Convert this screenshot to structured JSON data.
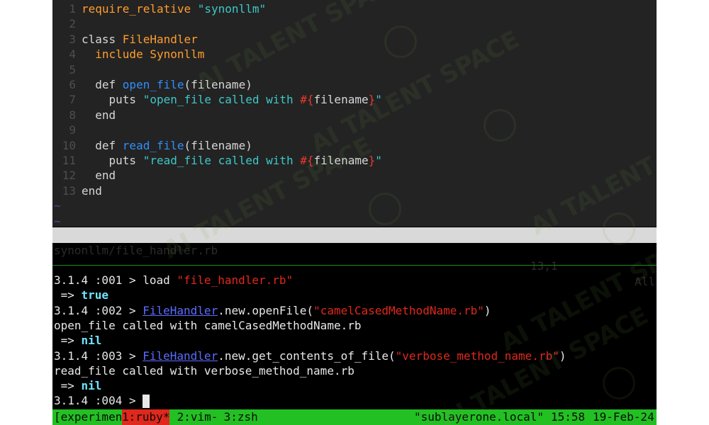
{
  "editor": {
    "lines": [
      {
        "n": "1",
        "segments": [
          {
            "t": "require_relative ",
            "c": "kw-o"
          },
          {
            "t": "\"synonllm\"",
            "c": "str"
          }
        ]
      },
      {
        "n": "2",
        "segments": []
      },
      {
        "n": "3",
        "segments": [
          {
            "t": "class ",
            "c": "kw"
          },
          {
            "t": "FileHandler",
            "c": "kw-o"
          }
        ]
      },
      {
        "n": "4",
        "segments": [
          {
            "t": "  include ",
            "c": "kw-o"
          },
          {
            "t": "Synonllm",
            "c": "kw-o"
          }
        ]
      },
      {
        "n": "5",
        "segments": []
      },
      {
        "n": "6",
        "segments": [
          {
            "t": "  def ",
            "c": "kw"
          },
          {
            "t": "open_file",
            "c": "fn"
          },
          {
            "t": "(filename)",
            "c": "kw"
          }
        ]
      },
      {
        "n": "7",
        "segments": [
          {
            "t": "    puts ",
            "c": "kw"
          },
          {
            "t": "\"open_file called with ",
            "c": "str"
          },
          {
            "t": "#{",
            "c": "interp"
          },
          {
            "t": "filename",
            "c": "kw"
          },
          {
            "t": "}",
            "c": "interp"
          },
          {
            "t": "\"",
            "c": "str"
          }
        ]
      },
      {
        "n": "8",
        "segments": [
          {
            "t": "  end",
            "c": "kw"
          }
        ]
      },
      {
        "n": "9",
        "segments": []
      },
      {
        "n": "10",
        "segments": [
          {
            "t": "  def ",
            "c": "kw"
          },
          {
            "t": "read_file",
            "c": "fn"
          },
          {
            "t": "(filename)",
            "c": "kw"
          }
        ]
      },
      {
        "n": "11",
        "segments": [
          {
            "t": "    puts ",
            "c": "kw"
          },
          {
            "t": "\"read_file called with ",
            "c": "str"
          },
          {
            "t": "#{",
            "c": "interp"
          },
          {
            "t": "filename",
            "c": "kw"
          },
          {
            "t": "}",
            "c": "interp"
          },
          {
            "t": "\"",
            "c": "str"
          }
        ]
      },
      {
        "n": "12",
        "segments": [
          {
            "t": "  end",
            "c": "kw"
          }
        ]
      },
      {
        "n": "13",
        "segments": [
          {
            "t": "end",
            "c": "kw"
          }
        ]
      }
    ],
    "tilde": "~",
    "tilde_count": 2
  },
  "vim_status": {
    "file": "synonllm/file_handler.rb",
    "position": "13,1",
    "scroll": "All"
  },
  "shell": {
    "lines": [
      [
        {
          "t": "3.1.4 :001 > load ",
          "c": ""
        },
        {
          "t": "\"file_handler.rb\"",
          "c": "r-red"
        }
      ],
      [
        {
          "t": " => ",
          "c": ""
        },
        {
          "t": "true",
          "c": "r-val"
        }
      ],
      [
        {
          "t": "3.1.4 :002 > ",
          "c": ""
        },
        {
          "t": "FileHandler",
          "c": "r-cls"
        },
        {
          "t": ".new.openFile(",
          "c": ""
        },
        {
          "t": "\"camelCasedMethodName.rb\"",
          "c": "r-red"
        },
        {
          "t": ")",
          "c": ""
        }
      ],
      [
        {
          "t": "open_file called with camelCasedMethodName.rb",
          "c": ""
        }
      ],
      [
        {
          "t": " => ",
          "c": ""
        },
        {
          "t": "nil",
          "c": "r-val"
        }
      ],
      [
        {
          "t": "3.1.4 :003 > ",
          "c": ""
        },
        {
          "t": "FileHandler",
          "c": "r-cls"
        },
        {
          "t": ".new.get_contents_of_file(",
          "c": ""
        },
        {
          "t": "\"verbose_method_name.rb\"",
          "c": "r-red"
        },
        {
          "t": ")",
          "c": ""
        }
      ],
      [
        {
          "t": "read_file called with verbose_method_name.rb",
          "c": ""
        }
      ],
      [
        {
          "t": " => ",
          "c": ""
        },
        {
          "t": "nil",
          "c": "r-val"
        }
      ],
      [
        {
          "t": "3.1.4 :004 > ",
          "c": ""
        }
      ]
    ]
  },
  "tmux": {
    "session": "[experimen",
    "active_window": "1:ruby*",
    "window_2": " 2:vim-",
    "window_3": " 3:zsh",
    "host": "\"sublayerone.local\"",
    "time": "15:58",
    "date": "19-Feb-24"
  },
  "watermark": {
    "text": "AI TALENT SPACE"
  },
  "colors": {
    "terminal_bg": "#000000",
    "editor_bg": "#232323",
    "tmux_bar": "#22c022",
    "tmux_active": "#e0281c",
    "vim_status_bg": "#d9d9d9"
  }
}
